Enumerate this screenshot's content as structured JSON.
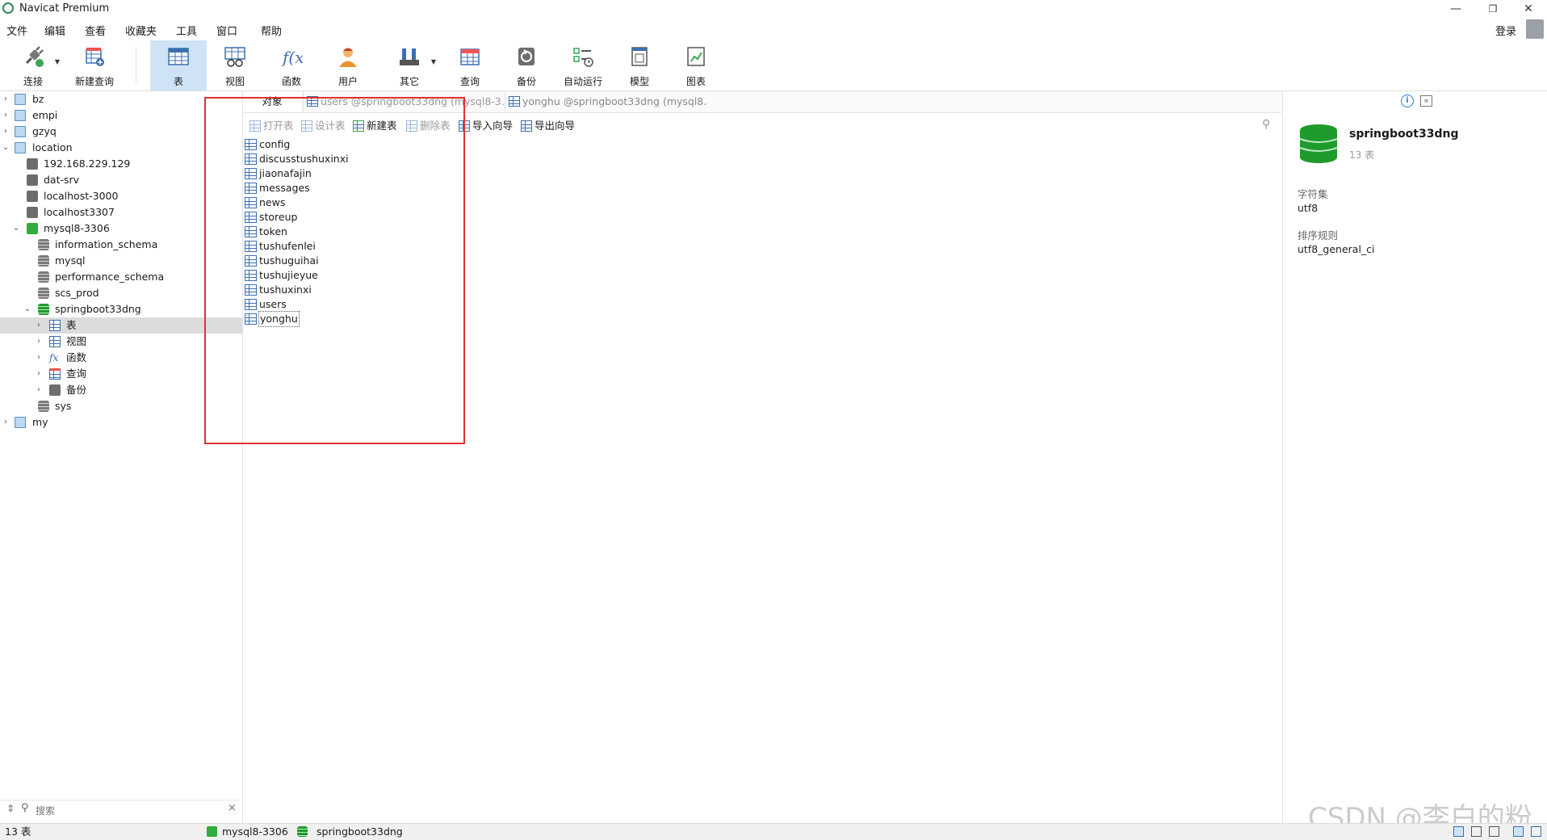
{
  "app": {
    "title": "Navicat Premium",
    "window_controls": {
      "minimize": "—",
      "restore": "❐",
      "close": "✕"
    }
  },
  "menu": {
    "items": [
      "文件",
      "编辑",
      "查看",
      "收藏夹",
      "工具",
      "窗口",
      "帮助"
    ],
    "login": "登录"
  },
  "toolbar": {
    "items": [
      {
        "label": "连接",
        "icon": "plug-icon",
        "has_caret": true
      },
      {
        "label": "新建查询",
        "icon": "new-query-icon",
        "has_caret": false
      },
      {
        "label": "表",
        "icon": "table-icon",
        "active": true
      },
      {
        "label": "视图",
        "icon": "view-icon"
      },
      {
        "label": "函数",
        "icon": "function-icon"
      },
      {
        "label": "用户",
        "icon": "user-icon"
      },
      {
        "label": "其它",
        "icon": "tools-icon",
        "has_caret": true
      },
      {
        "label": "查询",
        "icon": "query-icon"
      },
      {
        "label": "备份",
        "icon": "backup-icon"
      },
      {
        "label": "自动运行",
        "icon": "automation-icon"
      },
      {
        "label": "模型",
        "icon": "model-icon"
      },
      {
        "label": "图表",
        "icon": "chart-icon"
      }
    ]
  },
  "tree": [
    {
      "label": "bz",
      "type": "folder",
      "level": 0,
      "expanded": false
    },
    {
      "label": "empi",
      "type": "folder",
      "level": 0,
      "expanded": false
    },
    {
      "label": "gzyq",
      "type": "folder",
      "level": 0,
      "expanded": false
    },
    {
      "label": "location",
      "type": "folder",
      "level": 0,
      "expanded": true
    },
    {
      "label": "192.168.229.129",
      "type": "conn-gray",
      "level": 1
    },
    {
      "label": "dat-srv",
      "type": "conn-gray",
      "level": 1
    },
    {
      "label": "localhost-3000",
      "type": "conn-gray",
      "level": 1
    },
    {
      "label": "localhost3307",
      "type": "conn-gray",
      "level": 1
    },
    {
      "label": "mysql8-3306",
      "type": "conn-green",
      "level": 1,
      "expanded": true
    },
    {
      "label": "information_schema",
      "type": "db-gray",
      "level": 2
    },
    {
      "label": "mysql",
      "type": "db-gray",
      "level": 2
    },
    {
      "label": "performance_schema",
      "type": "db-gray",
      "level": 2
    },
    {
      "label": "scs_prod",
      "type": "db-gray",
      "level": 2
    },
    {
      "label": "springboot33dng",
      "type": "db-green",
      "level": 2,
      "expanded": true
    },
    {
      "label": "表",
      "type": "table",
      "level": 3,
      "expanded": false,
      "selected": true
    },
    {
      "label": "视图",
      "type": "view",
      "level": 3,
      "expanded": false
    },
    {
      "label": "函数",
      "type": "function",
      "level": 3,
      "expanded": false
    },
    {
      "label": "查询",
      "type": "query",
      "level": 3,
      "expanded": false
    },
    {
      "label": "备份",
      "type": "backup",
      "level": 3,
      "expanded": false
    },
    {
      "label": "sys",
      "type": "db-gray",
      "level": 2
    },
    {
      "label": "my",
      "type": "folder",
      "level": 0,
      "expanded": false
    }
  ],
  "search": {
    "placeholder": "搜索",
    "clear": "×"
  },
  "tabs": [
    {
      "label": "对象",
      "active": true
    },
    {
      "label": "users @springboot33dng (mysql8-3...",
      "active": false
    },
    {
      "label": "yonghu @springboot33dng (mysql8...",
      "active": false
    }
  ],
  "object_toolbar": [
    {
      "label": "打开表",
      "enabled": false
    },
    {
      "label": "设计表",
      "enabled": false
    },
    {
      "label": "新建表",
      "enabled": true
    },
    {
      "label": "删除表",
      "enabled": false
    },
    {
      "label": "导入向导",
      "enabled": true
    },
    {
      "label": "导出向导",
      "enabled": true
    }
  ],
  "tables": [
    "config",
    "discusstushuxinxi",
    "jiaonafajin",
    "messages",
    "news",
    "storeup",
    "token",
    "tushufenlei",
    "tushuguihai",
    "tushujieyue",
    "tushuxinxi",
    "users",
    "yonghu"
  ],
  "focused_table": "yonghu",
  "info": {
    "db_name": "springboot33dng",
    "table_count": "13 表",
    "charset_label": "字符集",
    "charset_value": "utf8",
    "collation_label": "排序规则",
    "collation_value": "utf8_general_ci"
  },
  "status": {
    "count": "13 表",
    "connection": "mysql8-3306",
    "database": "springboot33dng"
  },
  "watermark": "CSDN @李白的粉",
  "colors": {
    "accent": "#cfe3f7",
    "highlight_box": "#e03131",
    "db_green": "#1f9a2d"
  }
}
